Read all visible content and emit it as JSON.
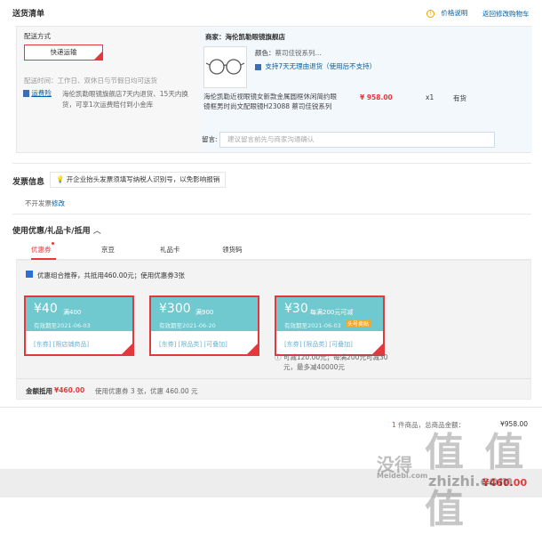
{
  "ship": {
    "title": "送货清单",
    "price_note": "价格说明",
    "back_cart": "返回修改购物车",
    "method_label": "配送方式",
    "method_value": "快递运输",
    "time": "配送时间：工作日、双休日与节假日均可送货",
    "yunfei_badge": "运费险",
    "yunfei_text1": "海伦凯勒眼镜旗舰店7天内退货、15天内换",
    "yunfei_text2": "货，可享1次运费赔付到小金库",
    "seller": "商家：海伦凯勒眼镜旗舰店",
    "product_color_label": "颜色：",
    "product_color": "蔡司佳锐系列...",
    "return_badge": "支持7天无理由退货（使用后不支持）",
    "product_name1": "海伦凯勒近视眼镜女新款金属圆框休闲简约眼",
    "product_name2": "镜框男时尚文配眼镜H23088 蔡司佳锐系列",
    "price": "¥ 958.00",
    "qty": "x1",
    "stock": "有货",
    "remark_label": "留言:",
    "remark_placeholder": "建议留言前先与商家沟通确认"
  },
  "invoice": {
    "title": "发票信息",
    "tip": "开企业抬头发票须填写纳税人识别号，以免影响报销",
    "status": "不开发票",
    "edit": "修改"
  },
  "discount": {
    "title": "使用优惠/礼品卡/抵用",
    "tabs": [
      "优惠券",
      "京豆",
      "礼品卡",
      "领货码"
    ],
    "combo_text": "优惠组合推荐，共抵用460.00元；使用优惠券3张",
    "coupons": [
      {
        "amount": "¥40",
        "cond": "满400",
        "valid": "有效期至2021-06-03",
        "tags": "[东券] [限店铺商品]",
        "badge": ""
      },
      {
        "amount": "¥300",
        "cond": "满900",
        "valid": "有效期至2021-06-20",
        "tags": "[东券] [限品类] [可叠加]",
        "badge": ""
      },
      {
        "amount": "¥30",
        "cond": "每满200元可减",
        "valid": "有效期至2021-06-03",
        "tags": "[东券] [限品类] [可叠加]",
        "badge": "头号卖贴"
      }
    ],
    "coupon3_note1": "ⓘ 可减120.00元；每满200元可减30",
    "coupon3_note2": "元，最多减40000元",
    "total_label": "金额抵用",
    "total_value": "¥460.00",
    "total_detail": "使用优惠券 3 张，优惠 460.00 元"
  },
  "summary": {
    "count_prefix": "1",
    "count_text": "件商品，总商品金额：",
    "count_value": "¥958.00",
    "pay_value": "¥460.00"
  },
  "watermark": {
    "big": "值 值 值",
    "left": "没得",
    "url": "Meidebi.com",
    "zh": "zhizhi.com"
  }
}
